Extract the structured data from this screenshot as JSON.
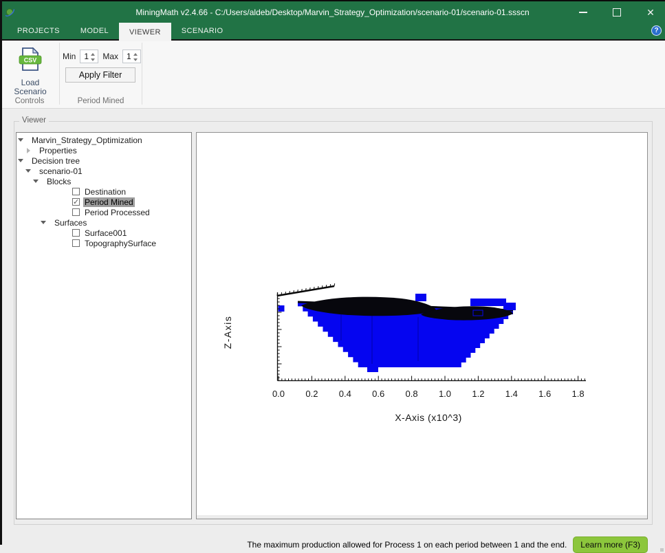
{
  "window": {
    "title": "MiningMath v2.4.66 - C:/Users/aldeb/Desktop/Marvin_Strategy_Optimization/scenario-01/scenario-01.ssscn"
  },
  "icons": {
    "close": "✕",
    "help": "?"
  },
  "tabs": [
    {
      "label": "PROJECTS"
    },
    {
      "label": "MODEL"
    },
    {
      "label": "VIEWER"
    },
    {
      "label": "SCENARIO"
    }
  ],
  "ribbon": {
    "load_scenario": {
      "icon_text": "CSV",
      "label_line1": "Load",
      "label_line2": "Scenario"
    },
    "min_label": "Min",
    "min_value": "1",
    "max_label": "Max",
    "max_value": "1",
    "apply_filter_label": "Apply Filter",
    "group_controls": "Controls",
    "group_period_mined": "Period Mined"
  },
  "viewer": {
    "group_label": "Viewer",
    "tree": {
      "items": [
        {
          "label": "Marvin_Strategy_Optimization",
          "indent": 25,
          "node": "expanded"
        },
        {
          "label": "Properties",
          "indent": 36,
          "node": "collapsed"
        },
        {
          "label": "Decision tree",
          "indent": 25,
          "node": "expanded"
        },
        {
          "label": "scenario-01",
          "indent": 36,
          "node": "expanded"
        },
        {
          "label": "Blocks",
          "indent": 47,
          "node": "expanded"
        },
        {
          "label": "Destination",
          "indent": 104,
          "node": "checkbox",
          "checked": false,
          "selected": false
        },
        {
          "label": "Period Mined",
          "indent": 104,
          "node": "checkbox",
          "checked": true,
          "selected": true
        },
        {
          "label": "Period Processed",
          "indent": 104,
          "node": "checkbox",
          "checked": false,
          "selected": false
        },
        {
          "label": "Surfaces",
          "indent": 58,
          "node": "expanded"
        },
        {
          "label": "Surface001",
          "indent": 104,
          "node": "checkbox",
          "checked": false,
          "selected": false
        },
        {
          "label": "TopographySurface",
          "indent": 104,
          "node": "checkbox",
          "checked": false,
          "selected": false
        }
      ]
    }
  },
  "viewport": {
    "z_axis_label": "Z-Axis",
    "x_axis_label": "X-Axis (x10^3)",
    "x_ticks": [
      "0.0",
      "0.2",
      "0.4",
      "0.6",
      "0.8",
      "1.0",
      "1.2",
      "1.4",
      "1.6",
      "1.8"
    ],
    "scene": {
      "ox": 117.5,
      "oy": 360.5,
      "ax_right": 566,
      "minor_dx": 4.84,
      "vax_top": 232,
      "labels_y": 384,
      "xlabel_pos": [
        337,
        419
      ],
      "zlabel_pos": [
        50,
        290
      ],
      "diag": [
        117,
        237,
        200,
        223
      ],
      "pit": {
        "tl": [
          147,
          245
        ],
        "tr": [
          460,
          257
        ],
        "br": [
          378,
          341
        ],
        "bl": [
          242,
          341
        ],
        "left_steps": 13,
        "right_steps": 12,
        "nub": [
          248,
          264,
          348
        ]
      },
      "pit_color": "#0505f0",
      "surface_color": "#07070d",
      "axis_color": "#0a0a0a",
      "surface_paths": [
        "M152,251 C185,239 245,236 298,241 C328,245 346,252 349,259 C318,267 255,268 208,264 C178,261 156,256 152,251 Z",
        "M326,264 C352,253 398,250 433,254 C450,257 460,260 460,263 C446,271 402,274 366,272 C345,270 330,268 326,264 Z"
      ],
      "blue_rects": [
        [
          318,
          234,
          16,
          11
        ],
        [
          398,
          241,
          52,
          11
        ],
        [
          446,
          247,
          18,
          11
        ],
        [
          118.5,
          251,
          9,
          9
        ]
      ],
      "seams": [
        [
          255,
          266,
          255,
          336
        ],
        [
          322,
          268,
          322,
          332
        ],
        [
          210,
          262,
          210,
          302
        ]
      ],
      "detail_rect": [
        402,
        258,
        14,
        8
      ]
    }
  },
  "statusbar": {
    "message": "The maximum production allowed for Process 1 on each period between 1 and the end.",
    "learn_more_label": "Learn more (F3)"
  }
}
